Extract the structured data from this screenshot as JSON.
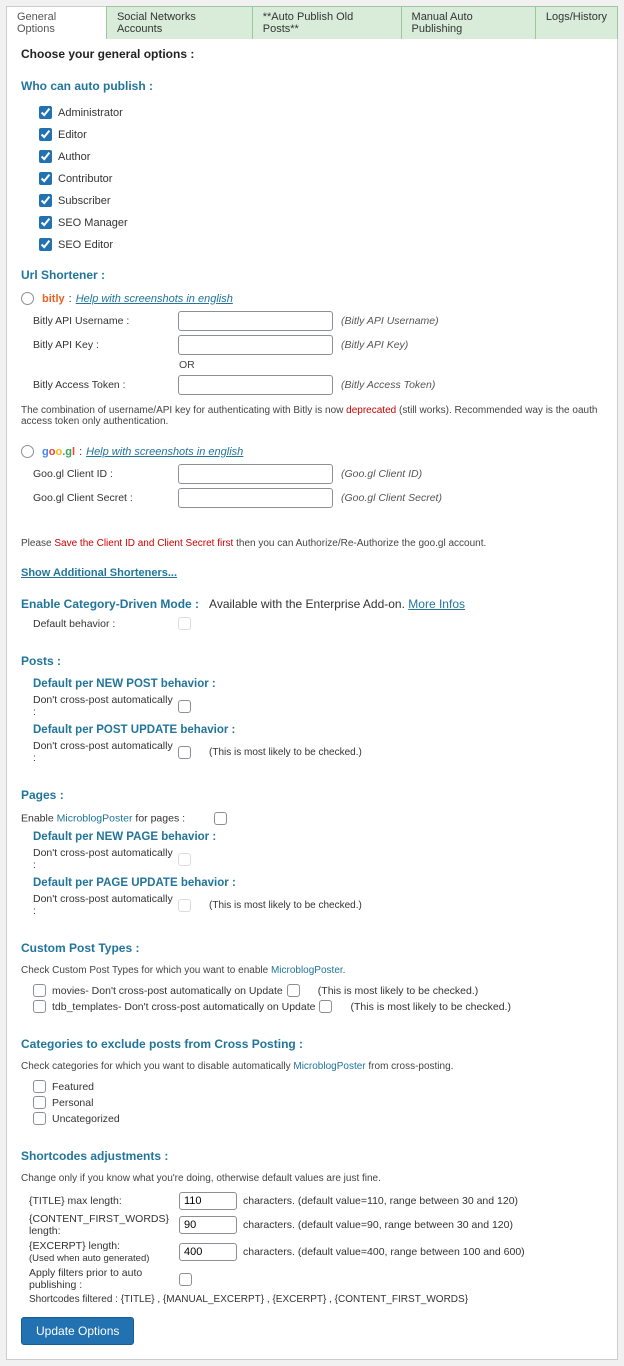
{
  "tabs": [
    "General Options",
    "Social Networks Accounts",
    "**Auto Publish Old Posts**",
    "Manual Auto Publishing",
    "Logs/History"
  ],
  "intro": "Choose your general options :",
  "who_can": {
    "heading": "Who can auto publish :",
    "roles": [
      "Administrator",
      "Editor",
      "Author",
      "Contributor",
      "Subscriber",
      "SEO Manager",
      "SEO Editor"
    ]
  },
  "url_shortener": {
    "heading": "Url Shortener :",
    "bitly": {
      "brand": "bitly",
      "help": "Help with screenshots in english",
      "username_label": "Bitly API Username :",
      "username_hint": "(Bitly API Username)",
      "key_label": "Bitly API Key :",
      "key_hint": "(Bitly API Key)",
      "or": "OR",
      "token_label": "Bitly Access Token :",
      "token_hint": "(Bitly Access Token)",
      "warn_pre": "The combination of username/API key for authenticating with Bitly is now ",
      "warn_dep": "deprecated",
      "warn_post": " (still works). Recommended way is the oauth access token only authentication.",
      "user_ph": "",
      "key_ph": "",
      "token_ph": ""
    },
    "googl": {
      "help": "Help with screenshots in english",
      "id_label": "Goo.gl Client ID :",
      "id_hint": "(Goo.gl Client ID)",
      "secret_label": "Goo.gl Client Secret :",
      "secret_hint": "(Goo.gl Client Secret)",
      "save_pre": "Please ",
      "save_red": "Save the Client ID and Client Secret first",
      "save_post": " then you can Authorize/Re-Authorize the goo.gl account."
    },
    "show_more": "Show Additional Shorteners..."
  },
  "category_mode": {
    "label": "Enable Category-Driven Mode :",
    "avail": "Available with the Enterprise Add-on.",
    "more": "More Infos",
    "default_behavior": "Default behavior :"
  },
  "posts": {
    "heading": "Posts :",
    "new_heading": "Default per NEW POST behavior :",
    "new_cb": "Don't cross-post automatically :",
    "upd_heading": "Default per POST UPDATE behavior :",
    "upd_cb": "Don't cross-post automatically :",
    "upd_note": "(This is most likely to be checked.)"
  },
  "pages": {
    "heading": "Pages :",
    "enable_pre": "Enable ",
    "enable_brand": "MicroblogPoster",
    "enable_post": " for pages :",
    "new_heading": "Default per NEW PAGE behavior :",
    "new_cb": "Don't cross-post automatically :",
    "upd_heading": "Default per PAGE UPDATE behavior :",
    "upd_cb": "Don't cross-post automatically :",
    "upd_note": "(This is most likely to be checked.)"
  },
  "cpt": {
    "heading": "Custom Post Types :",
    "desc_pre": "Check Custom Post Types for which you want to enable ",
    "desc_brand": "MicroblogPoster",
    "desc_post": ".",
    "movies": "movies",
    "movies_sep": "  -  Don't cross-post automatically on Update",
    "movies_note": "(This is most likely to be checked.)",
    "tdb": "tdb_templates",
    "tdb_sep": "  -  Don't cross-post automatically on Update",
    "tdb_note": "(This is most likely to be checked.)"
  },
  "categories": {
    "heading": "Categories to exclude posts from Cross Posting :",
    "desc_pre": "Check categories for which you want to disable automatically ",
    "desc_brand": "MicroblogPoster",
    "desc_post": " from cross-posting.",
    "list": [
      "Featured",
      "Personal",
      "Uncategorized"
    ]
  },
  "shortcodes": {
    "heading": "Shortcodes adjustments :",
    "desc": "Change only if you know what you're doing, otherwise default values are just fine.",
    "title_label": "{TITLE} max length:",
    "title_val": "110",
    "title_note": "characters.  (default value=110, range between 30 and 120)",
    "cfw_label": "{CONTENT_FIRST_WORDS} length:",
    "cfw_val": "90",
    "cfw_note": "characters.  (default value=90, range between 30 and 120)",
    "excerpt_label": "{EXCERPT} length:",
    "excerpt_sub": "(Used when auto generated)",
    "excerpt_val": "400",
    "excerpt_note": "characters.  (default value=400, range between 100 and 600)",
    "filters_label": "Apply filters prior to auto publishing :",
    "filtered": "Shortcodes filtered : {TITLE} , {MANUAL_EXCERPT} , {EXCERPT} , {CONTENT_FIRST_WORDS}"
  },
  "submit": "Update Options"
}
